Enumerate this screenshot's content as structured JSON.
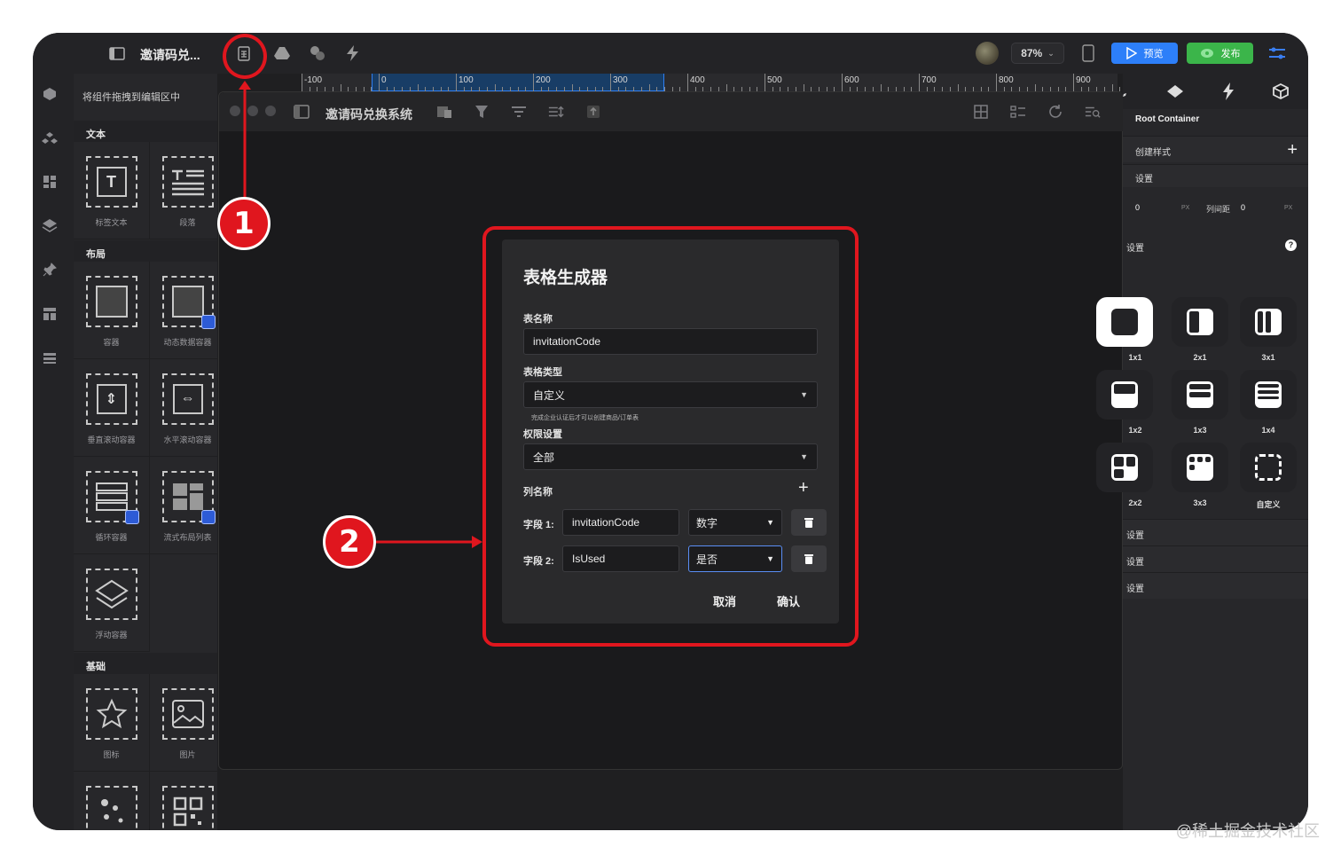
{
  "topbar": {
    "project_title": "邀请码兑...",
    "zoom": "87%",
    "preview_label": "预览",
    "publish_label": "发布"
  },
  "components": {
    "drag_hint": "将组件拖拽到编辑区中",
    "sections": [
      {
        "title": "文本",
        "items": [
          "标签文本",
          "段落"
        ]
      },
      {
        "title": "布局",
        "items": [
          "容器",
          "动态数据容器",
          "垂直滚动容器",
          "水平滚动容器",
          "循环容器",
          "流式布局列表",
          "浮动容器"
        ]
      },
      {
        "title": "基础",
        "items": [
          "图标",
          "图片"
        ]
      }
    ]
  },
  "ruler": {
    "labels": [
      "-100",
      "0",
      "100",
      "200",
      "300",
      "400",
      "500",
      "600",
      "700",
      "800",
      "900"
    ]
  },
  "simulator": {
    "title": "邀请码兑换系统"
  },
  "dialog": {
    "title": "表格生成器",
    "table_name_label": "表名称",
    "table_name_value": "invitationCode",
    "table_type_label": "表格类型",
    "table_type_value": "自定义",
    "table_type_hint": "完成企业认证后才可以创建商品/订单表",
    "permission_label": "权限设置",
    "permission_value": "全部",
    "columns_label": "列名称",
    "fields": [
      {
        "label": "字段 1:",
        "name": "invitationCode",
        "type": "数字"
      },
      {
        "label": "字段 2:",
        "name": "IsUsed",
        "type": "是否"
      }
    ],
    "cancel_label": "取消",
    "confirm_label": "确认"
  },
  "annotations": {
    "badge_1": "1",
    "badge_2": "2"
  },
  "right_panel": {
    "root_container": "Root Container",
    "create_style": "创建样式",
    "layout_settings": "设置",
    "row_gap_value": "0",
    "row_gap_unit": "PX",
    "col_gap_label": "列间距",
    "col_gap_value": "0",
    "col_gap_unit": "PX",
    "grid_settings": "设置",
    "grid_options": [
      "1x1",
      "2x1",
      "3x1",
      "1x2",
      "1x3",
      "1x4",
      "2x2",
      "3x3",
      "自定义"
    ],
    "settings_rows": [
      "设置",
      "设置",
      "设置"
    ]
  },
  "watermark": "@稀土掘金技术社区",
  "colors": {
    "accent": "#2d7ff9",
    "publish": "#3bb54a",
    "annotation_red": "#e0161e"
  }
}
